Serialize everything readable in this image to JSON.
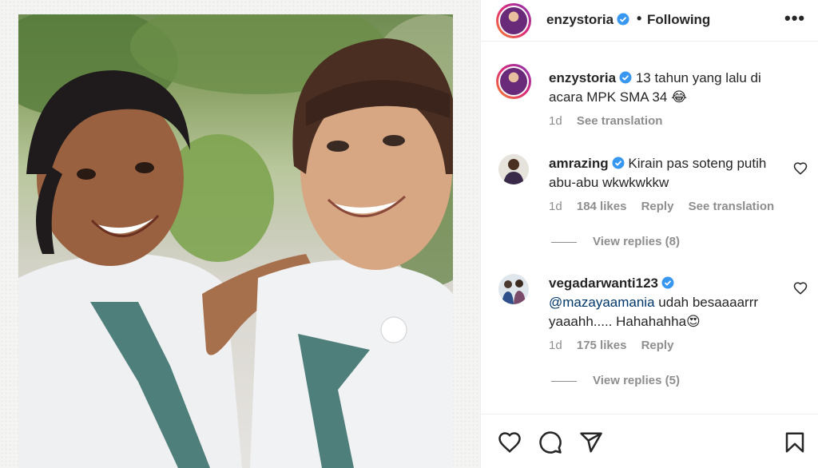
{
  "post": {
    "author": "enzystoria",
    "follow_status": "Following",
    "separator": "•",
    "more_label": "•••"
  },
  "caption": {
    "username": "enzystoria",
    "text": "13 tahun yang lalu di acara MPK SMA 34",
    "emoji": "😂",
    "time": "1d",
    "translate": "See translation"
  },
  "comments": [
    {
      "username": "amrazing",
      "text": "Kirain pas soteng putih abu-abu wkwkwkkw",
      "time": "1d",
      "likes": "184 likes",
      "reply": "Reply",
      "translate": "See translation",
      "view_replies": "View replies (8)"
    },
    {
      "username": "vegadarwanti123",
      "mention": "@mazayaamania",
      "text": "udah besaaaarrr yaaahh..... Hahahahha",
      "emoji": "😍",
      "time": "1d",
      "likes": "175 likes",
      "reply": "Reply",
      "view_replies": "View replies (5)"
    }
  ],
  "colors": {
    "verified": "#3897f0",
    "text": "#262626",
    "secondary": "#8e8e8e",
    "mention": "#00376b",
    "ring_start": "#f58529",
    "ring_end": "#8134af"
  },
  "icons": {
    "like": "heart-icon",
    "comment": "comment-icon",
    "share": "send-icon",
    "save": "bookmark-icon"
  }
}
